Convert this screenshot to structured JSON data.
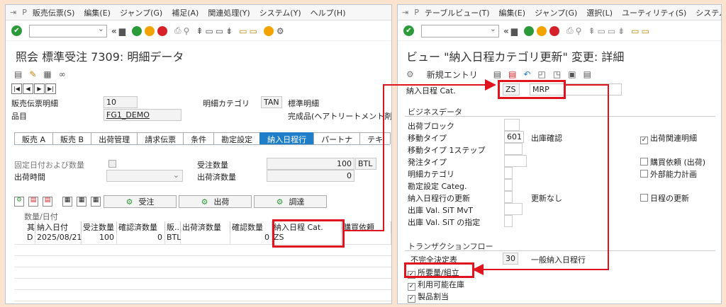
{
  "left": {
    "menu": [
      "販売伝票(S)",
      "編集(E)",
      "ジャンプ(G)",
      "補足(A)",
      "関連処理(Y)",
      "システム(Y)",
      "ヘルプ(H)"
    ],
    "title": "照会 標準受注 7309: 明細データ",
    "header": {
      "item_label": "販売伝票明細",
      "item_value": "10",
      "cat_label": "明細カテゴリ",
      "cat_value": "TAN",
      "cat_desc": "標準明細",
      "material_label": "品目",
      "material_value": "FG1_DEMO",
      "material_desc": "完成品(ヘアトリートメント剤)"
    },
    "tabs": [
      "販売 A",
      "販売 B",
      "出荷管理",
      "請求伝票",
      "条件",
      "勘定設定",
      "納入日程行",
      "パートナ",
      "テキ"
    ],
    "active_tab": "納入日程行",
    "fields": {
      "fixed_label": "固定日付および数量",
      "ship_time_label": "出荷時間",
      "order_qty_label": "受注数量",
      "order_qty_value": "100",
      "order_qty_unit": "BTL",
      "shipped_qty_label": "出荷済数量",
      "shipped_qty_value": "0"
    },
    "buttons": [
      "受注",
      "出荷",
      "調達"
    ],
    "qty_date_label": "数量/日付",
    "table": {
      "headers": [
        "其",
        "納入日付",
        "受注数量",
        "確認済数量",
        "販..",
        "出荷済数量",
        "確認数量",
        "納入日程 Cat.",
        "購買依頼"
      ],
      "row": [
        "D",
        "2025/08/21",
        "100",
        "0",
        "BTL",
        "",
        "0",
        "ZS",
        ""
      ]
    }
  },
  "right": {
    "menu": [
      "テーブルビュー(T)",
      "編集(E)",
      "ジャンプ(G)",
      "選択(L)",
      "ユーティリティ(S)",
      "システム"
    ],
    "title": "ビュー \"納入日程カテゴリ更新\" 変更: 詳細",
    "new_entry": "新規エントリ",
    "cat_label": "納入日程 Cat.",
    "cat_value": "ZS",
    "cat_desc": "MRP",
    "business_data": {
      "header": "ビジネスデータ",
      "delivery_block": "出荷ブロック",
      "movement_type": "移動タイプ",
      "movement_value": "601",
      "movement_desc": "出庫確認",
      "movement_1step": "移動タイプ 1ステップ",
      "order_type": "発注タイプ",
      "item_cat": "明細カテゴリ",
      "acct_cat": "勘定設定 Categ.",
      "sched_update": "納入日程行の更新",
      "sched_update_desc": "更新なし",
      "ship_mvt": "出庫 Val. SiT MvT",
      "ship_sit": "出庫 Val. SiT の指定",
      "chk_delivery_item": "出荷関連明細",
      "chk_purch_req": "購買依頼 (出荷)",
      "chk_ext_cap": "外部能力計画",
      "chk_sched_update": "日程の更新"
    },
    "transaction_flow": {
      "header": "トランザクションフロー",
      "incompletion_label": "不完全決定表",
      "incompletion_value": "30",
      "incompletion_desc": "一般納入日程行",
      "req_assembly": "所要量/組立",
      "atp": "利用可能在庫",
      "alloc": "製品割当"
    }
  },
  "colors": {
    "accent_red": "#e0141e",
    "tab_active": "#1e7fc8"
  }
}
